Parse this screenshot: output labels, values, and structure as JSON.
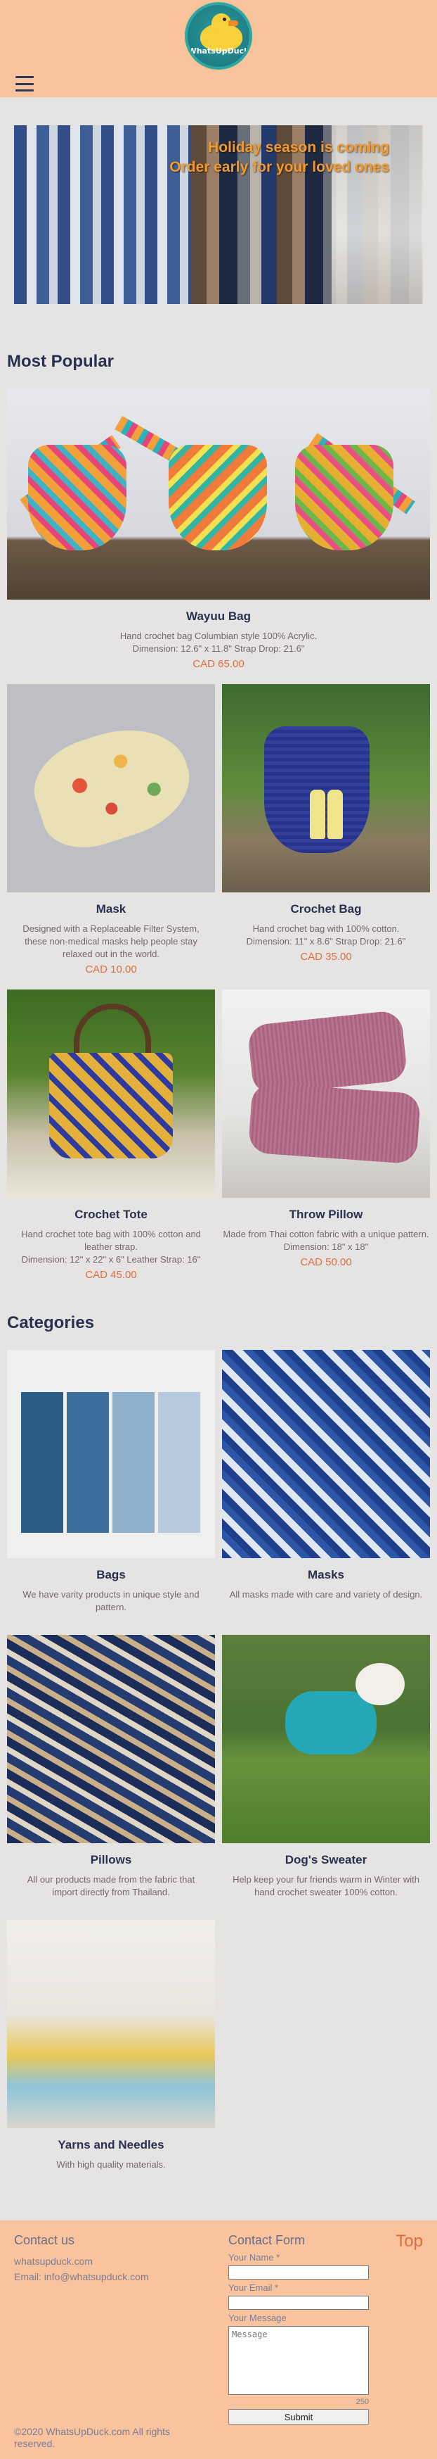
{
  "header": {
    "logo_text": "WhatsUpDuck",
    "menu_icon": "hamburger-menu-icon"
  },
  "hero": {
    "line1": "Holiday season is coming",
    "line2": "Order early for your loved ones"
  },
  "most_popular": {
    "title": "Most Popular",
    "products": [
      {
        "name": "Wayuu Bag",
        "desc1": "Hand crochet bag Columbian style 100% Acrylic.",
        "desc2": "Dimension: 12.6\" x 11.8\" Strap Drop: 21.6\"",
        "price": "CAD 65.00"
      },
      {
        "name": "Mask",
        "desc1": "Designed with a Replaceable Filter System, these non-medical masks help people stay relaxed out in the world.",
        "price": "CAD 10.00"
      },
      {
        "name": "Crochet Bag",
        "desc1": "Hand crochet bag with 100% cotton.",
        "desc2": "Dimension: 11\" x 8.6\" Strap Drop: 21.6\"",
        "price": "CAD 35.00"
      },
      {
        "name": "Crochet Tote",
        "desc1": "Hand crochet tote bag with 100% cotton and leather strap.",
        "desc2": "Dimension: 12\" x 22\" x 6\" Leather Strap: 16\"",
        "price": "CAD 45.00"
      },
      {
        "name": "Throw Pillow",
        "desc1": "Made from Thai cotton fabric with a unique pattern.",
        "desc2": "Dimension: 18\" x 18\"",
        "price": "CAD 50.00"
      }
    ]
  },
  "categories": {
    "title": "Categories",
    "items": [
      {
        "name": "Bags",
        "desc": "We have varity products in unique style and pattern."
      },
      {
        "name": "Masks",
        "desc": "All masks made with care and variety of design."
      },
      {
        "name": "Pillows",
        "desc": "All our products made from the fabric that import directly from Thailand."
      },
      {
        "name": "Dog's Sweater",
        "desc": "Help keep your fur friends warm in Winter with hand crochet sweater 100% cotton."
      },
      {
        "name": "Yarns and Needles",
        "desc": "With high quality materials."
      }
    ]
  },
  "footer": {
    "contact_title": "Contact us",
    "website": "whatsupduck.com",
    "email": "Email: info@whatsupduck.com",
    "form_title": "Contact Form",
    "name_label": "Your Name *",
    "email_label": "Your Email *",
    "message_label": "Your Message",
    "message_placeholder": "Message",
    "counter": "250",
    "submit_label": "Submit",
    "top_link": "Top",
    "copyright": "©2020 WhatsUpDuck.com All rights reserved."
  },
  "colors": {
    "header_bg": "#f8c39d",
    "page_bg": "#e6e4e3",
    "title": "#2b3050",
    "price": "#e06d3c",
    "hero_text": "#f39a2b"
  }
}
